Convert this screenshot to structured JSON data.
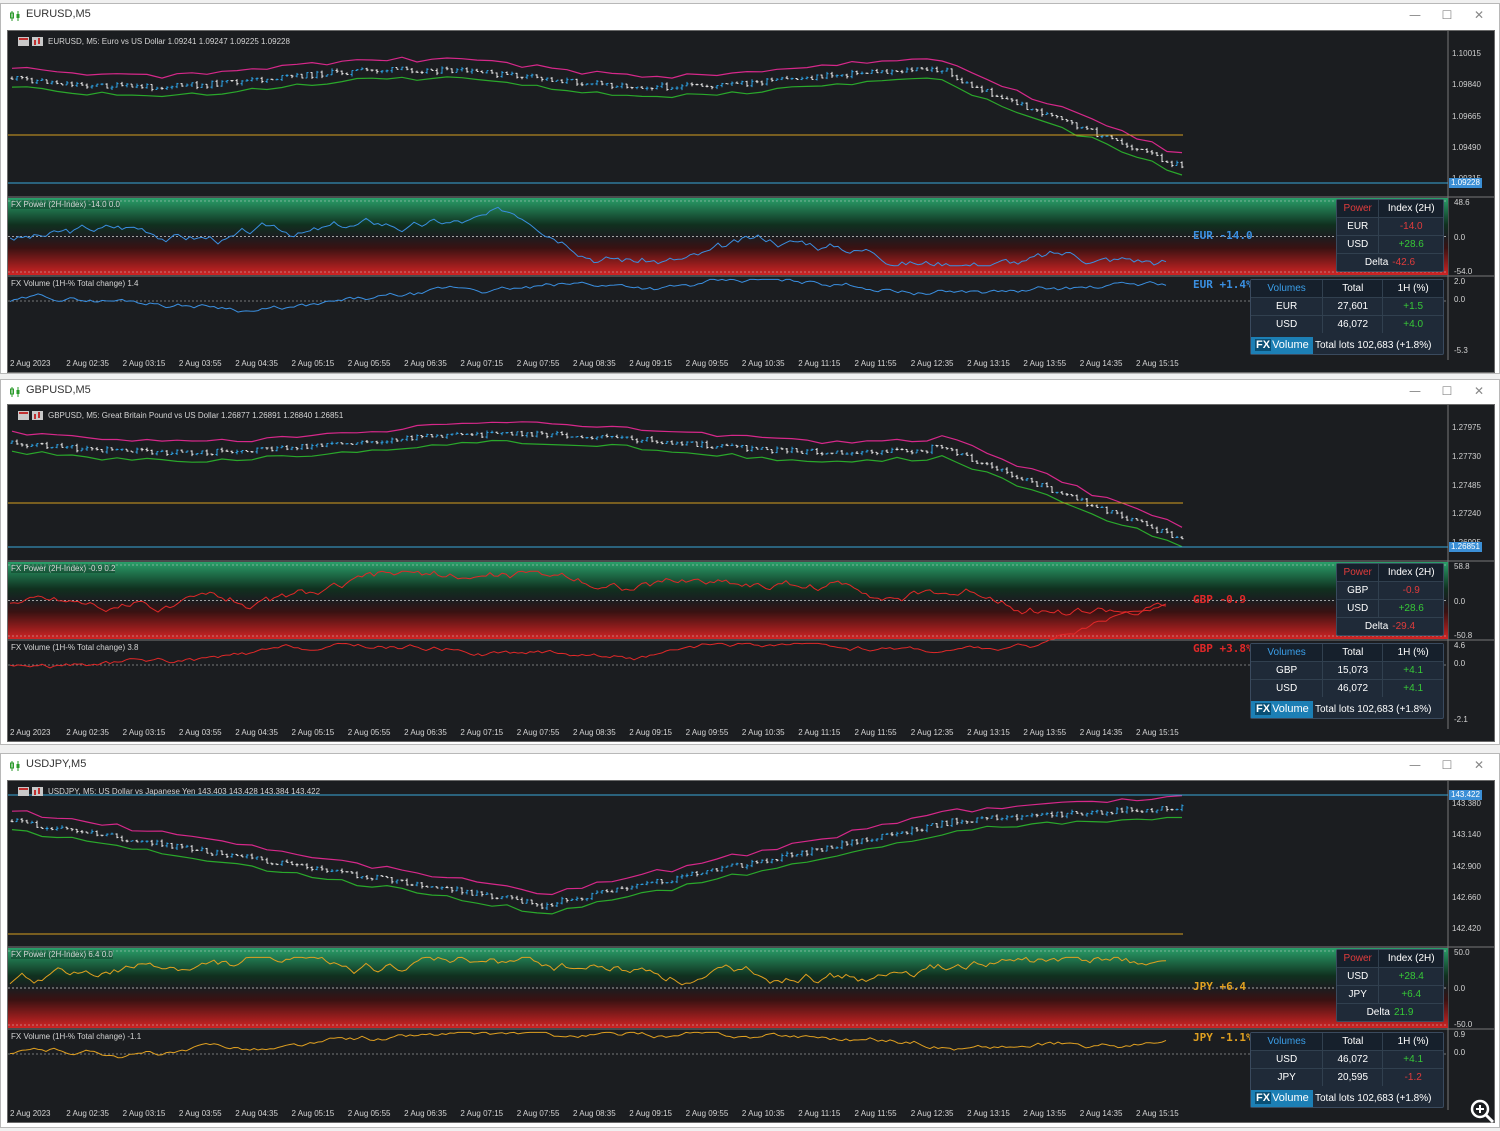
{
  "windows": [
    {
      "id": "eurusd",
      "title": "EURUSD,M5",
      "info": "EURUSD, M5:  Euro vs US Dollar  1.09241 1.09247 1.09225 1.09228",
      "price_labels": [
        "1.10015",
        "1.09840",
        "1.09665",
        "1.09490",
        "1.09315"
      ],
      "current_price": "1.09228",
      "power_title": "FX Power (2H-Index) -14.0 0.0",
      "power_axis": [
        "48.6",
        "0.0",
        "-54.0"
      ],
      "power_tag": "EUR  -14.0",
      "power_tag_color": "#3a8fe0",
      "volume_title": "FX Volume (1H-% Total change)  1.4",
      "volume_axis": [
        "2.0",
        "0.0",
        "-5.3"
      ],
      "volume_tag": "EUR  +1.4%",
      "volume_tag_color": "#3a8fe0",
      "power_panel": {
        "header": [
          "Power",
          "Index (2H)"
        ],
        "rows": [
          {
            "ccy": "EUR",
            "val": "-14.0",
            "color": "#e03c3c"
          },
          {
            "ccy": "USD",
            "val": "+28.6",
            "color": "#37c837"
          }
        ],
        "delta_label": "Delta",
        "delta": "-42.6",
        "delta_color": "#e03c3c"
      },
      "volume_panel": {
        "header": [
          "Volumes",
          "Total",
          "1H (%)"
        ],
        "rows": [
          {
            "ccy": "EUR",
            "total": "27,601",
            "chg": "+1.5",
            "color": "#37c837"
          },
          {
            "ccy": "USD",
            "total": "46,072",
            "chg": "+4.0",
            "color": "#37c837"
          }
        ],
        "brand": "Volume",
        "brand_prefix": "FX",
        "total_lots": "Total lots 102,683 (+1.8%)"
      }
    },
    {
      "id": "gbpusd",
      "title": "GBPUSD,M5",
      "info": "GBPUSD, M5:  Great Britain Pound vs US Dollar  1.26877 1.26891 1.26840 1.26851",
      "price_labels": [
        "1.27975",
        "1.27730",
        "1.27485",
        "1.27240",
        "1.26995"
      ],
      "current_price": "1.26851",
      "power_title": "FX Power (2H-Index) -0.9 0.2",
      "power_axis": [
        "58.8",
        "0.0",
        "-50.8"
      ],
      "power_tag": "GBP   -0.9",
      "power_tag_color": "#e02828",
      "volume_title": "FX Volume (1H-% Total change)  3.8",
      "volume_axis": [
        "4.6",
        "0.0",
        "-2.1"
      ],
      "volume_tag": "GBP  +3.8%",
      "volume_tag_color": "#e02828",
      "power_panel": {
        "header": [
          "Power",
          "Index (2H)"
        ],
        "rows": [
          {
            "ccy": "GBP",
            "val": "-0.9",
            "color": "#e03c3c"
          },
          {
            "ccy": "USD",
            "val": "+28.6",
            "color": "#37c837"
          }
        ],
        "delta_label": "Delta",
        "delta": "-29.4",
        "delta_color": "#e03c3c"
      },
      "volume_panel": {
        "header": [
          "Volumes",
          "Total",
          "1H (%)"
        ],
        "rows": [
          {
            "ccy": "GBP",
            "total": "15,073",
            "chg": "+4.1",
            "color": "#37c837"
          },
          {
            "ccy": "USD",
            "total": "46,072",
            "chg": "+4.1",
            "color": "#37c837"
          }
        ],
        "brand": "Volume",
        "brand_prefix": "FX",
        "total_lots": "Total lots 102,683 (+1.8%)"
      }
    },
    {
      "id": "usdjpy",
      "title": "USDJPY,M5",
      "info": "USDJPY, M5:  US Dollar vs Japanese Yen  143.403 143.428 143.384 143.422",
      "price_labels": [
        "143.380",
        "143.140",
        "142.900",
        "142.660",
        "142.420"
      ],
      "current_price": "143.422",
      "power_title": "FX Power (2H-Index) 6.4 0.0",
      "power_axis": [
        "50.0",
        "0.0",
        "-50.0"
      ],
      "power_tag": "JPY  +6.4",
      "power_tag_color": "#e0a020",
      "volume_title": "FX Volume (1H-% Total change)  -1.1",
      "volume_axis": [
        "0.9",
        "0.0"
      ],
      "volume_tag": "JPY  -1.1%",
      "volume_tag_color": "#e0a020",
      "power_panel": {
        "header": [
          "Power",
          "Index (2H)"
        ],
        "rows": [
          {
            "ccy": "USD",
            "val": "+28.4",
            "color": "#37c837"
          },
          {
            "ccy": "JPY",
            "val": "+6.4",
            "color": "#37c837"
          }
        ],
        "delta_label": "Delta",
        "delta": "21.9",
        "delta_color": "#37c837"
      },
      "volume_panel": {
        "header": [
          "Volumes",
          "Total",
          "1H (%)"
        ],
        "rows": [
          {
            "ccy": "USD",
            "total": "46,072",
            "chg": "+4.1",
            "color": "#37c837"
          },
          {
            "ccy": "JPY",
            "total": "20,595",
            "chg": "-1.2",
            "color": "#e03c3c"
          }
        ],
        "brand": "Volume",
        "brand_prefix": "FX",
        "total_lots": "Total lots 102,683 (+1.8%)"
      }
    }
  ],
  "time_labels": [
    "2 Aug 2023",
    "2 Aug 02:35",
    "2 Aug 03:15",
    "2 Aug 03:55",
    "2 Aug 04:35",
    "2 Aug 05:15",
    "2 Aug 05:55",
    "2 Aug 06:35",
    "2 Aug 07:15",
    "2 Aug 07:55",
    "2 Aug 08:35",
    "2 Aug 09:15",
    "2 Aug 09:55",
    "2 Aug 10:35",
    "2 Aug 11:15",
    "2 Aug 11:55",
    "2 Aug 12:35",
    "2 Aug 13:15",
    "2 Aug 13:55",
    "2 Aug 14:35",
    "2 Aug 15:15"
  ],
  "window_buttons": {
    "min": "—",
    "max": "☐",
    "close": "✕"
  },
  "colors": {
    "bull": "#2ea3e6",
    "bear": "#e8e8e8",
    "upper_band": "#d6288a",
    "lower_band": "#2ecc2e",
    "level": "#d4a020",
    "price_line": "#3aa6d8"
  }
}
